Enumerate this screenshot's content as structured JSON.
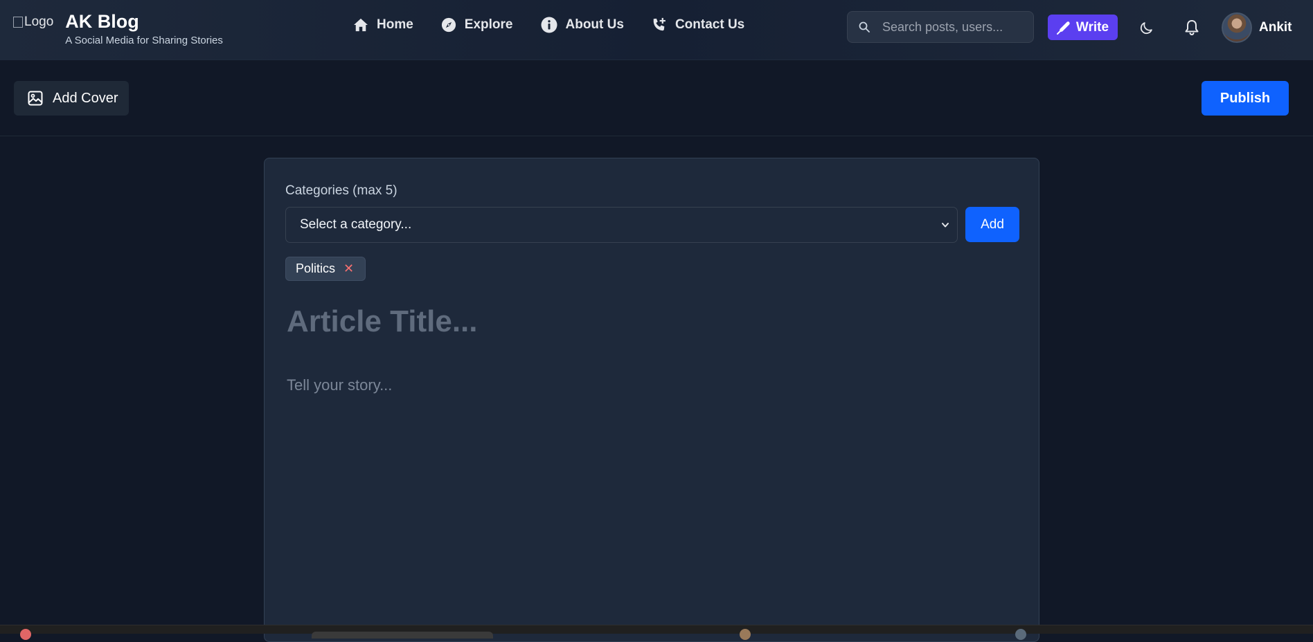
{
  "header": {
    "logo_alt": "Logo",
    "brand_title": "AK Blog",
    "brand_subtitle": "A Social Media for Sharing Stories",
    "nav": [
      {
        "label": "Home",
        "icon": "home-icon"
      },
      {
        "label": "Explore",
        "icon": "compass-icon"
      },
      {
        "label": "About Us",
        "icon": "info-icon"
      },
      {
        "label": "Contact Us",
        "icon": "phone-plus-icon"
      }
    ],
    "search": {
      "placeholder": "Search posts, users...",
      "value": ""
    },
    "write_label": "Write",
    "user_name": "Ankit"
  },
  "toolbar": {
    "add_cover_label": "Add Cover",
    "publish_label": "Publish"
  },
  "editor": {
    "categories_label": "Categories (max 5)",
    "category_select_value": "Select a category...",
    "add_label": "Add",
    "selected_categories": [
      "Politics"
    ],
    "remove_glyph": "✕",
    "title_placeholder": "Article Title...",
    "story_placeholder": "Tell your story..."
  },
  "colors": {
    "background": "#111827",
    "card": "#1e293b",
    "primary": "#0f62fe",
    "write_accent": "#5b3ff0",
    "remove_icon": "#f87171"
  }
}
